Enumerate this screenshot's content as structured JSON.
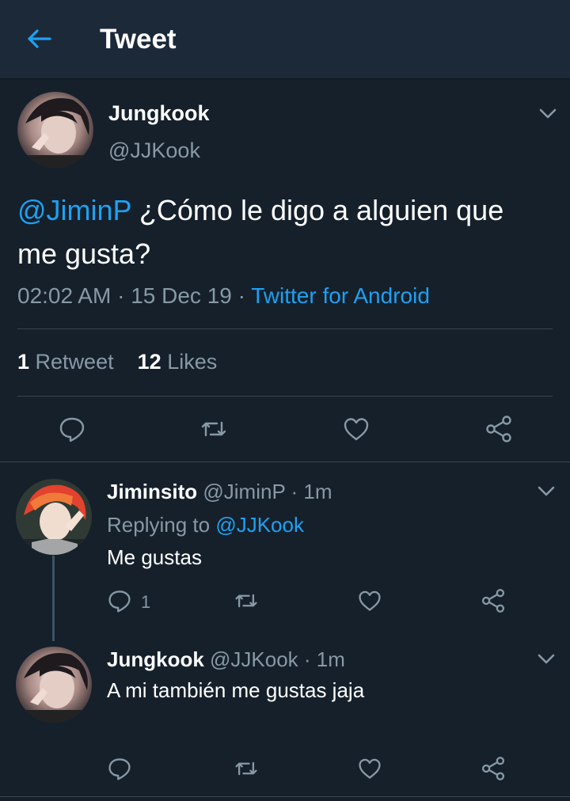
{
  "header": {
    "title": "Tweet"
  },
  "tweet": {
    "author": {
      "name": "Jungkook",
      "handle": "@JJKook"
    },
    "mention": "@JiminP",
    "text": " ¿Cómo le digo a alguien que me gusta?",
    "time": "02:02 AM",
    "date": "15 Dec 19",
    "source": "Twitter for Android",
    "sep": " · ",
    "retweets": {
      "count": "1",
      "label": "Retweet"
    },
    "likes": {
      "count": "12",
      "label": "Likes"
    }
  },
  "replies": [
    {
      "name": "Jiminsito",
      "handle": "@JiminP",
      "time": "1m",
      "replying_prefix": "Replying to ",
      "replying_handle": "@JJKook",
      "text": "Me gustas",
      "reply_count": "1"
    },
    {
      "name": "Jungkook",
      "handle": "@JJKook",
      "time": "1m",
      "text": "A mi también me gustas jaja"
    }
  ],
  "colors": {
    "background": "#15202b",
    "header": "#1c2938",
    "accent": "#1da1f2",
    "muted": "#8899a6"
  },
  "icons": [
    "back-arrow-icon",
    "chevron-down-icon",
    "reply-icon",
    "retweet-icon",
    "like-icon",
    "share-icon"
  ]
}
